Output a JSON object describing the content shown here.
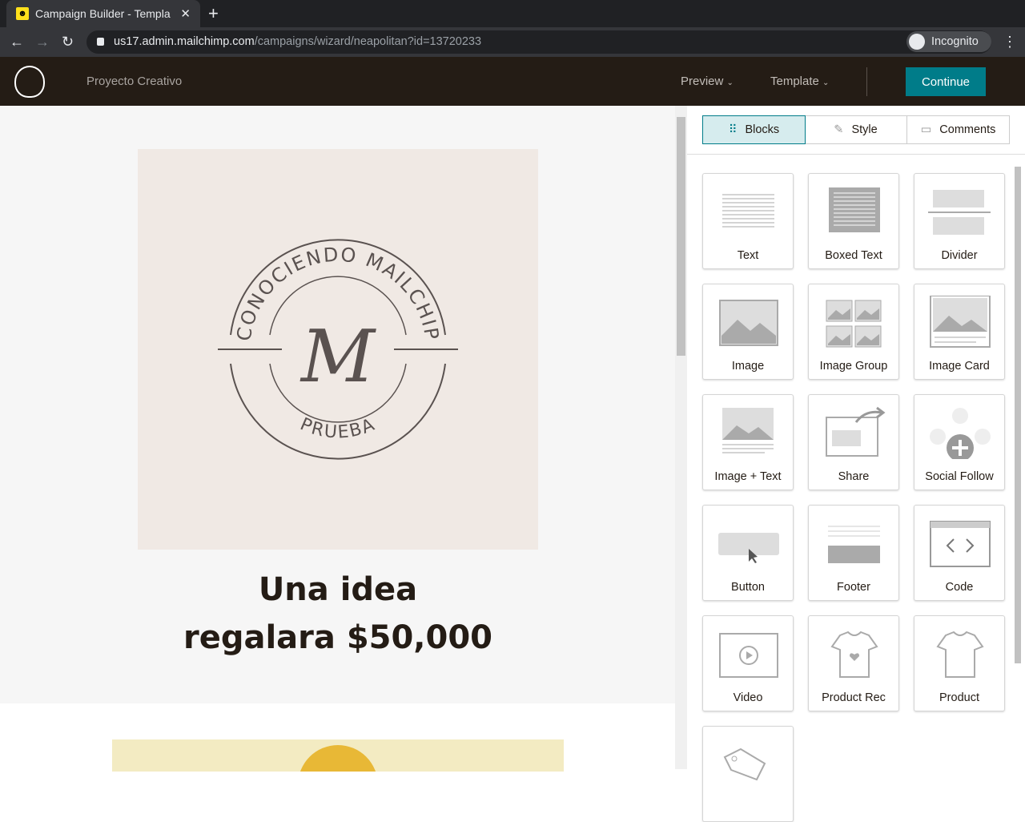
{
  "browser": {
    "tab_title": "Campaign Builder - Templa",
    "url_host": "us17.admin.mailchimp.com",
    "url_path": "/campaigns/wizard/neapolitan?id=13720233",
    "profile": "Incognito"
  },
  "header": {
    "campaign_name": "Proyecto Creativo",
    "preview": "Preview",
    "template": "Template",
    "continue": "Continue"
  },
  "email": {
    "logo_text_top": "CONOCIENDO MAILCHIP",
    "logo_letter": "M",
    "logo_text_bottom": "PRUEBA",
    "headline_line1": "Una idea",
    "headline_line2": "regalara $50,000"
  },
  "panel": {
    "tabs": [
      "Blocks",
      "Style",
      "Comments"
    ],
    "blocks": [
      "Text",
      "Boxed Text",
      "Divider",
      "Image",
      "Image Group",
      "Image Card",
      "Image + Text",
      "Share",
      "Social Follow",
      "Button",
      "Footer",
      "Code",
      "Video",
      "Product Rec",
      "Product",
      ""
    ]
  },
  "colors": {
    "accent": "#007c89",
    "header_bg": "#241c15"
  }
}
